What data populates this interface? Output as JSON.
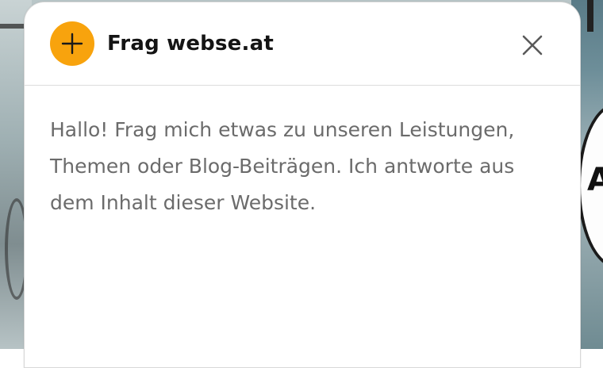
{
  "background": {
    "bubble_text": "A"
  },
  "chat_panel": {
    "title": "Frag webse.at",
    "brand_icon": "plus-icon",
    "close_icon": "close-icon",
    "accent_color": "#f8a30d",
    "intro_message": "Hallo! Frag mich etwas zu unseren Leistungen, Themen oder Blog-Beiträgen. Ich antworte aus dem Inhalt dieser Website."
  }
}
